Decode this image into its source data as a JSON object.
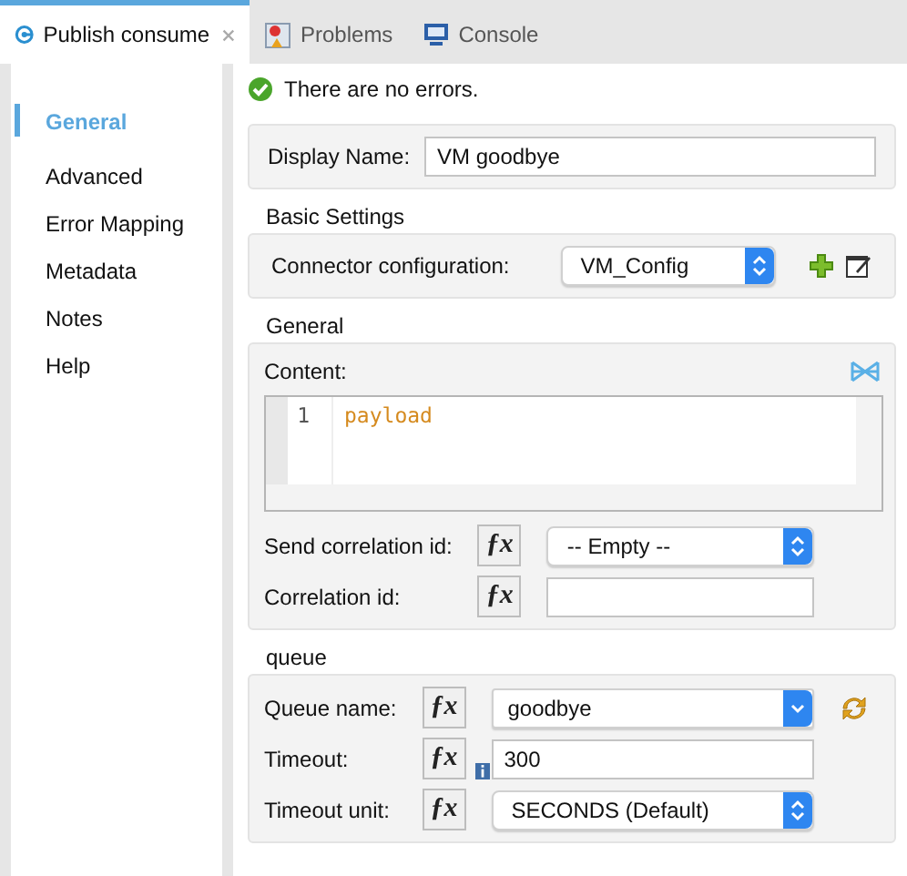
{
  "tabs": [
    {
      "label": "Publish consume",
      "kind": "editor",
      "selected": true,
      "closable": true
    },
    {
      "label": "Problems",
      "kind": "problems",
      "selected": false,
      "closable": false
    },
    {
      "label": "Console",
      "kind": "console",
      "selected": false,
      "closable": false
    }
  ],
  "sidebar": {
    "items": [
      {
        "label": "General",
        "selected": true
      },
      {
        "label": "Advanced",
        "selected": false
      },
      {
        "label": "Error Mapping",
        "selected": false
      },
      {
        "label": "Metadata",
        "selected": false
      },
      {
        "label": "Notes",
        "selected": false
      },
      {
        "label": "Help",
        "selected": false
      }
    ]
  },
  "status": {
    "kind": "ok",
    "text": "There are no errors."
  },
  "display_name": {
    "label": "Display Name:",
    "value": "VM goodbye"
  },
  "groups": [
    {
      "title": "Basic Settings",
      "rows": [
        {
          "kind": "config",
          "label": "Connector configuration:",
          "value": "VM_Config"
        }
      ]
    },
    {
      "title": "General",
      "rows": [
        {
          "kind": "editor",
          "label": "Content:",
          "lines": [
            {
              "number": "1",
              "text": "payload"
            }
          ]
        },
        {
          "kind": "select",
          "label": "Send correlation id:",
          "value": "-- Empty --",
          "expression": "ƒx"
        },
        {
          "kind": "text",
          "label": "Correlation id:",
          "value": "",
          "expression": "ƒx"
        }
      ]
    },
    {
      "title": "queue",
      "rows": [
        {
          "kind": "combo",
          "label": "Queue name:",
          "value": "goodbye",
          "expression": "ƒx"
        },
        {
          "kind": "number",
          "label": "Timeout:",
          "value": "300",
          "expression": "ƒx"
        },
        {
          "kind": "select",
          "label": "Timeout unit:",
          "value": "SECONDS (Default)",
          "expression": "ƒx"
        }
      ]
    }
  ]
}
